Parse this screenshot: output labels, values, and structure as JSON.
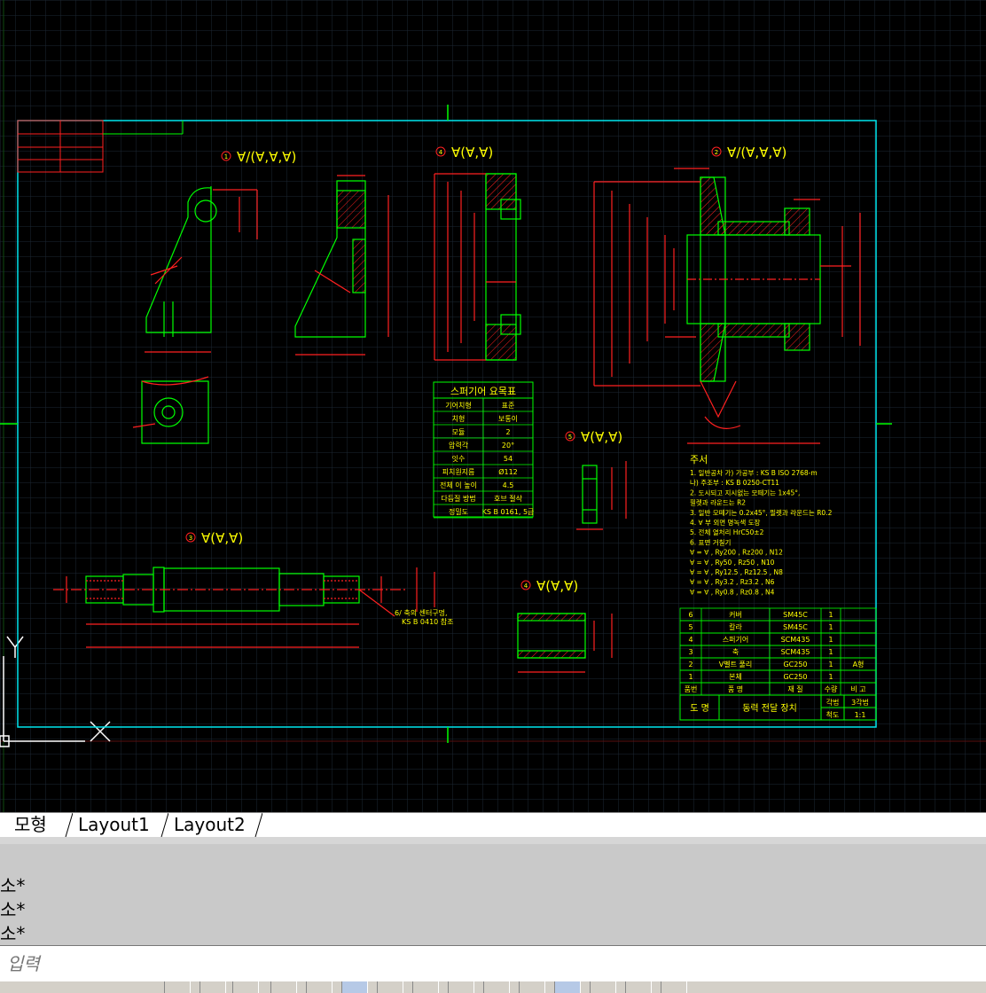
{
  "drawing": {
    "background": "#000000",
    "grid_color": "#1f2a36",
    "frame_color": "#00e5ee",
    "geometry_color": "#00ff00",
    "dimension_color": "#ff2020",
    "text_color": "#ffff00",
    "part_labels": [
      {
        "num": "1",
        "finish": "∀/(∀,∀,∀)"
      },
      {
        "num": "4",
        "finish": "∀(∀,∀)"
      },
      {
        "num": "2",
        "finish": "∀/(∀,∀,∀)"
      },
      {
        "num": "5",
        "finish": "∀(∀,∀)"
      },
      {
        "num": "3",
        "finish": "∀(∀,∀)"
      },
      {
        "num": "4",
        "finish": "∀(∀,∀)"
      }
    ],
    "spur_table": {
      "title": "스퍼기어 요목표",
      "rows": [
        [
          "기어치형",
          "표준"
        ],
        [
          "치형",
          "보통이"
        ],
        [
          "모듈",
          "2"
        ],
        [
          "압력각",
          "20°"
        ],
        [
          "잇수",
          "54"
        ],
        [
          "피치원지름",
          "Ø112"
        ],
        [
          "전체 이 높이",
          "4.5"
        ],
        [
          "다듬질 방법",
          "호브 절삭"
        ],
        [
          "정밀도",
          "KS B 0161, 5급"
        ]
      ]
    },
    "notes": {
      "title": "주서",
      "lines": [
        "1. 일반공차  가) 가공부 : KS B ISO 2768-m",
        "             나) 주조부 : KS B 0250-CT11",
        "2. 도시되고 지시없는 모떼기는 1x45°,",
        "   필렛과 라운드는 R2",
        "3. 일반 모떼기는 0.2x45°, 필렛과 라운드는 R0.2",
        "4. ∀ 부 외면 명녹색 도장",
        "5. 전체 열처리 HrC50±2",
        "6. 표면 거칠기",
        "∀ = ∀ , Ry200 , Rz200 , N12",
        "∀ = ∀ , Ry50 , Rz50 , N10",
        "∀ = ∀ , Ry12.5 , Rz12.5 , N8",
        "∀ = ∀ , Ry3.2 , Rz3.2 , N6",
        "∀ = ∀ , Ry0.8 , Rz0.8 , N4"
      ]
    },
    "parts_list": {
      "rows": [
        [
          "6",
          "커버",
          "SM45C",
          "1",
          ""
        ],
        [
          "5",
          "칼라",
          "SM45C",
          "1",
          ""
        ],
        [
          "4",
          "스퍼기어",
          "SCM435",
          "1",
          ""
        ],
        [
          "3",
          "축",
          "SCM435",
          "1",
          ""
        ],
        [
          "2",
          "V벨트 풀리",
          "GC250",
          "1",
          "A형"
        ],
        [
          "1",
          "본체",
          "GC250",
          "1",
          ""
        ]
      ],
      "header": [
        "품번",
        "품 명",
        "재 질",
        "수량",
        "비 고"
      ],
      "title_row": {
        "label": "도 명",
        "name": "동력 전달 장치",
        "proj_label": "각법",
        "proj": "3각법",
        "scale_label": "척도",
        "scale": "1:1"
      }
    },
    "callout": "6/ 축의 센터구멍,\nKS B 0410 참조"
  },
  "tabs": [
    {
      "label": "모형",
      "active": true
    },
    {
      "label": "Layout1",
      "active": false
    },
    {
      "label": "Layout2",
      "active": false
    }
  ],
  "command_history": [
    "소*",
    "소*",
    "소*"
  ],
  "command_input": {
    "placeholder": "입력"
  }
}
